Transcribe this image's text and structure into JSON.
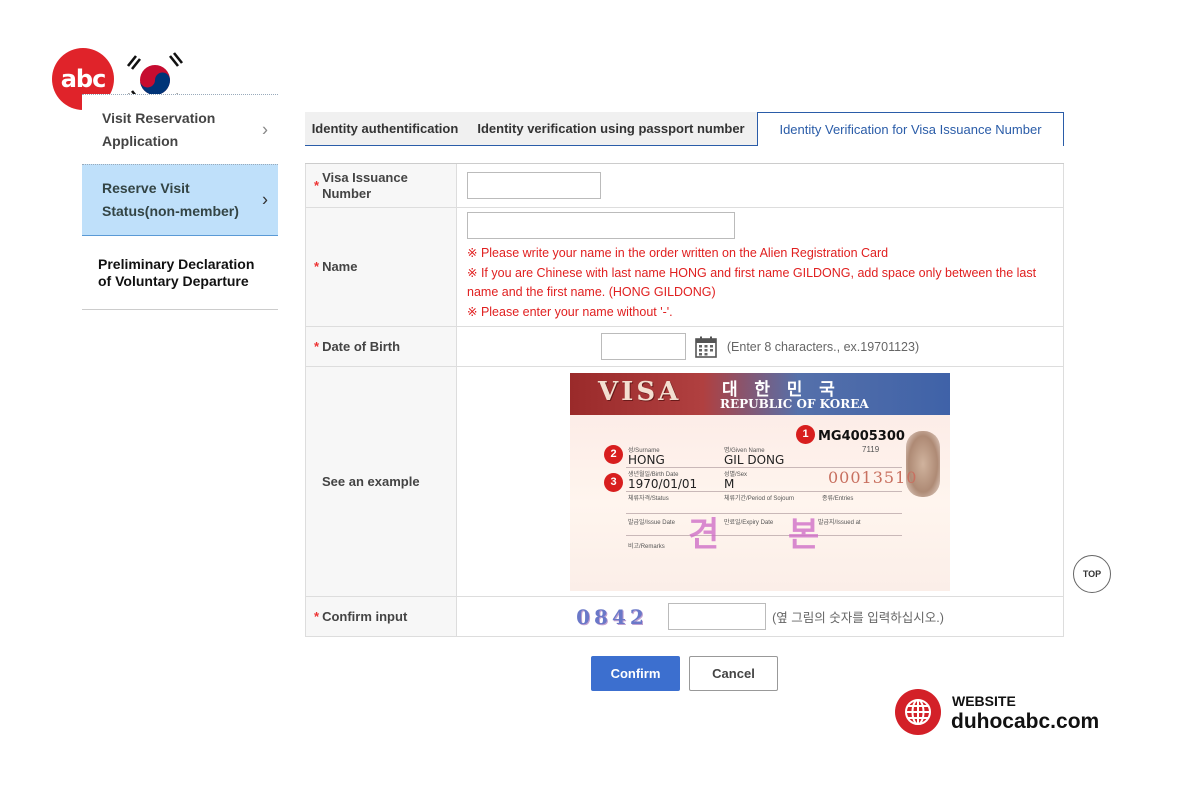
{
  "logo": {
    "text": "abc"
  },
  "sidebar": {
    "items": [
      {
        "label": "Visit Reservation Application"
      },
      {
        "label": "Reserve Visit Status(non-member)"
      },
      {
        "label": "Preliminary Declaration of Voluntary Departure"
      }
    ]
  },
  "tabs": [
    {
      "label": "Identity authentification"
    },
    {
      "label": "Identity verification using passport number"
    },
    {
      "label": "Identity Verification for Visa Issuance Number",
      "active": true
    }
  ],
  "form": {
    "required_mark": "*",
    "visa_number": {
      "label": "Visa Issuance Number",
      "value": ""
    },
    "name": {
      "label": "Name",
      "value": "",
      "notes": [
        "※ Please write your name in the order written on the Alien Registration Card",
        "※ If you are Chinese with last name HONG and first name GILDONG, add space only between the last name and the first name. (HONG GILDONG)",
        "※ Please enter your name without '-'."
      ]
    },
    "dob": {
      "label": "Date of Birth",
      "value": "",
      "hint": "(Enter 8 characters., ex.19701123)"
    },
    "example": {
      "label": "See an example",
      "visa_word": "VISA",
      "korean_title": "대 한 민 국",
      "republic": "REPUBLIC OF KOREA",
      "visa_number": "MG4005300",
      "surname_label": "성/Surname",
      "surname": "HONG",
      "given_label": "명/Given Name",
      "given": "GIL DONG",
      "small_code": "7119",
      "birth_label": "생년월일/Birth Date",
      "birth": "1970/01/01",
      "sex_label": "성별/Sex",
      "sex": "M",
      "serial": "00013510",
      "status_label": "체류자격/Status",
      "period_label": "체류기간/Period of Sojourn",
      "entries_label": "종류/Entries",
      "issue_label": "발급일/Issue Date",
      "expiry_label": "만료일/Expiry Date",
      "issued_at_label": "발급지/Issued at",
      "remarks_label": "비고/Remarks",
      "stamp_left": "견",
      "stamp_right": "본",
      "badges": [
        "1",
        "2",
        "3"
      ]
    },
    "confirm_input": {
      "label": "Confirm input",
      "captcha": "0842",
      "value": "",
      "hint": "(옆 그림의 숫자를 입력하십시오.)"
    }
  },
  "buttons": {
    "confirm": "Confirm",
    "cancel": "Cancel"
  },
  "top_button": "TOP",
  "website": {
    "label": "WEBSITE",
    "url": "duhocabc.com"
  },
  "colors": {
    "accent": "#3c6fcf",
    "active_sidebar": "#bfe0fa",
    "note_red": "#e02020",
    "brand_red": "#d32028"
  }
}
